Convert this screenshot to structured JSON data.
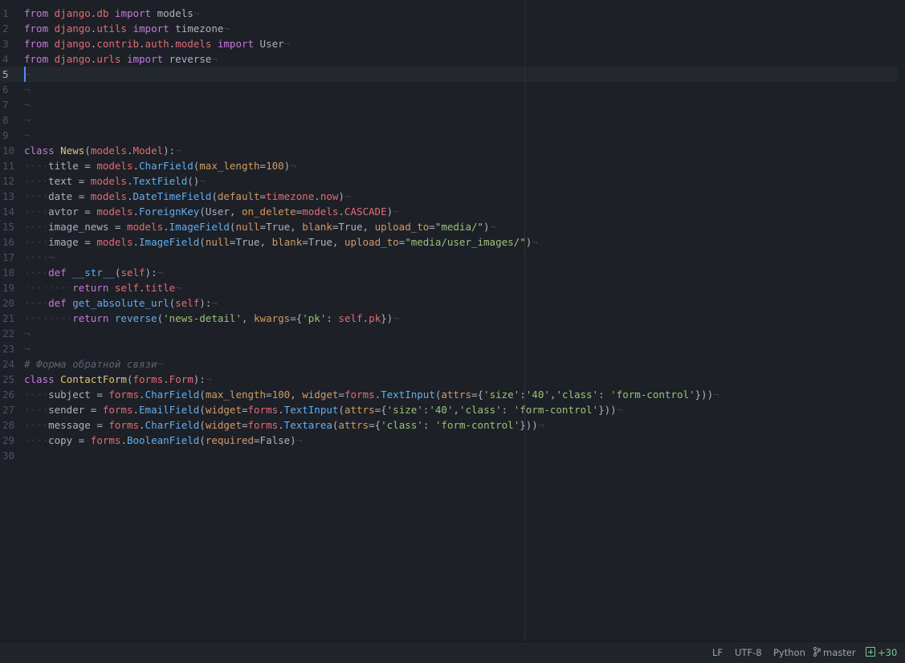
{
  "editor": {
    "active_line": 5,
    "line_numbers": [
      "1",
      "2",
      "3",
      "4",
      "5",
      "6",
      "7",
      "8",
      "9",
      "10",
      "11",
      "12",
      "13",
      "14",
      "15",
      "16",
      "17",
      "18",
      "19",
      "20",
      "21",
      "22",
      "23",
      "24",
      "25",
      "26",
      "27",
      "28",
      "29",
      "30"
    ],
    "eol_marker": "¬",
    "indent_marker": "····",
    "lines": [
      [
        [
          "kw",
          "from"
        ],
        [
          "plain",
          " "
        ],
        [
          "mod",
          "django"
        ],
        [
          "plain",
          "."
        ],
        [
          "mod",
          "db"
        ],
        [
          "plain",
          " "
        ],
        [
          "kw",
          "import"
        ],
        [
          "plain",
          " models"
        ]
      ],
      [
        [
          "kw",
          "from"
        ],
        [
          "plain",
          " "
        ],
        [
          "mod",
          "django"
        ],
        [
          "plain",
          "."
        ],
        [
          "mod",
          "utils"
        ],
        [
          "plain",
          " "
        ],
        [
          "kw",
          "import"
        ],
        [
          "plain",
          " timezone"
        ]
      ],
      [
        [
          "kw",
          "from"
        ],
        [
          "plain",
          " "
        ],
        [
          "mod",
          "django"
        ],
        [
          "plain",
          "."
        ],
        [
          "mod",
          "contrib"
        ],
        [
          "plain",
          "."
        ],
        [
          "mod",
          "auth"
        ],
        [
          "plain",
          "."
        ],
        [
          "mod",
          "models"
        ],
        [
          "plain",
          " "
        ],
        [
          "kw",
          "import"
        ],
        [
          "plain",
          " User"
        ]
      ],
      [
        [
          "kw",
          "from"
        ],
        [
          "plain",
          " "
        ],
        [
          "mod",
          "django"
        ],
        [
          "plain",
          "."
        ],
        [
          "mod",
          "urls"
        ],
        [
          "plain",
          " "
        ],
        [
          "kw",
          "import"
        ],
        [
          "plain",
          " reverse"
        ]
      ],
      [],
      [],
      [],
      [],
      [],
      [
        [
          "kw",
          "class"
        ],
        [
          "plain",
          " "
        ],
        [
          "cls",
          "News"
        ],
        [
          "plain",
          "("
        ],
        [
          "mod",
          "models"
        ],
        [
          "plain",
          "."
        ],
        [
          "mod",
          "Model"
        ],
        [
          "plain",
          "):"
        ]
      ],
      [
        [
          "ws",
          "····"
        ],
        [
          "plain",
          "title = "
        ],
        [
          "mod",
          "models"
        ],
        [
          "plain",
          "."
        ],
        [
          "fn",
          "CharField"
        ],
        [
          "plain",
          "("
        ],
        [
          "param",
          "max_length"
        ],
        [
          "plain",
          "="
        ],
        [
          "num",
          "100"
        ],
        [
          "plain",
          ")"
        ]
      ],
      [
        [
          "ws",
          "····"
        ],
        [
          "plain",
          "text = "
        ],
        [
          "mod",
          "models"
        ],
        [
          "plain",
          "."
        ],
        [
          "fn",
          "TextField"
        ],
        [
          "plain",
          "()"
        ]
      ],
      [
        [
          "ws",
          "····"
        ],
        [
          "plain",
          "date = "
        ],
        [
          "mod",
          "models"
        ],
        [
          "plain",
          "."
        ],
        [
          "fn",
          "DateTimeField"
        ],
        [
          "plain",
          "("
        ],
        [
          "param",
          "default"
        ],
        [
          "plain",
          "="
        ],
        [
          "mod",
          "timezone"
        ],
        [
          "plain",
          "."
        ],
        [
          "mod",
          "now"
        ],
        [
          "plain",
          ")"
        ]
      ],
      [
        [
          "ws",
          "····"
        ],
        [
          "plain",
          "avtor = "
        ],
        [
          "mod",
          "models"
        ],
        [
          "plain",
          "."
        ],
        [
          "fn",
          "ForeignKey"
        ],
        [
          "plain",
          "(User, "
        ],
        [
          "param",
          "on_delete"
        ],
        [
          "plain",
          "="
        ],
        [
          "mod",
          "models"
        ],
        [
          "plain",
          "."
        ],
        [
          "mod",
          "CASCADE"
        ],
        [
          "plain",
          ")"
        ]
      ],
      [
        [
          "ws",
          "····"
        ],
        [
          "plain",
          "image_news = "
        ],
        [
          "mod",
          "models"
        ],
        [
          "plain",
          "."
        ],
        [
          "fn",
          "ImageField"
        ],
        [
          "plain",
          "("
        ],
        [
          "param",
          "null"
        ],
        [
          "plain",
          "=True, "
        ],
        [
          "param",
          "blank"
        ],
        [
          "plain",
          "=True, "
        ],
        [
          "param",
          "upload_to"
        ],
        [
          "plain",
          "="
        ],
        [
          "str",
          "\"media/\""
        ],
        [
          "plain",
          ")"
        ]
      ],
      [
        [
          "ws",
          "····"
        ],
        [
          "plain",
          "image = "
        ],
        [
          "mod",
          "models"
        ],
        [
          "plain",
          "."
        ],
        [
          "fn",
          "ImageField"
        ],
        [
          "plain",
          "("
        ],
        [
          "param",
          "null"
        ],
        [
          "plain",
          "=True, "
        ],
        [
          "param",
          "blank"
        ],
        [
          "plain",
          "=True, "
        ],
        [
          "param",
          "upload_to"
        ],
        [
          "plain",
          "="
        ],
        [
          "str",
          "\"media/user_images/\""
        ],
        [
          "plain",
          ")"
        ]
      ],
      [
        [
          "ws",
          "····"
        ]
      ],
      [
        [
          "ws",
          "····"
        ],
        [
          "kw",
          "def"
        ],
        [
          "plain",
          " "
        ],
        [
          "fn",
          "__str__"
        ],
        [
          "plain",
          "("
        ],
        [
          "self",
          "self"
        ],
        [
          "plain",
          "):"
        ]
      ],
      [
        [
          "ws",
          "········"
        ],
        [
          "kw",
          "return"
        ],
        [
          "plain",
          " "
        ],
        [
          "self",
          "self"
        ],
        [
          "plain",
          "."
        ],
        [
          "attr",
          "title"
        ]
      ],
      [
        [
          "ws",
          "····"
        ],
        [
          "kw",
          "def"
        ],
        [
          "plain",
          " "
        ],
        [
          "fn",
          "get_absolute_url"
        ],
        [
          "plain",
          "("
        ],
        [
          "self",
          "self"
        ],
        [
          "plain",
          "):"
        ]
      ],
      [
        [
          "ws",
          "········"
        ],
        [
          "kw",
          "return"
        ],
        [
          "plain",
          " "
        ],
        [
          "fn",
          "reverse"
        ],
        [
          "plain",
          "("
        ],
        [
          "str",
          "'news-detail'"
        ],
        [
          "plain",
          ", "
        ],
        [
          "param",
          "kwargs"
        ],
        [
          "plain",
          "={"
        ],
        [
          "str",
          "'pk'"
        ],
        [
          "plain",
          ": "
        ],
        [
          "self",
          "self"
        ],
        [
          "plain",
          "."
        ],
        [
          "attr",
          "pk"
        ],
        [
          "plain",
          "})"
        ]
      ],
      [],
      [],
      [
        [
          "cmt",
          "# Форма обратной связи"
        ]
      ],
      [
        [
          "kw",
          "class"
        ],
        [
          "plain",
          " "
        ],
        [
          "cls",
          "ContactForm"
        ],
        [
          "plain",
          "("
        ],
        [
          "mod",
          "forms"
        ],
        [
          "plain",
          "."
        ],
        [
          "mod",
          "Form"
        ],
        [
          "plain",
          "):"
        ]
      ],
      [
        [
          "ws",
          "····"
        ],
        [
          "plain",
          "subject = "
        ],
        [
          "mod",
          "forms"
        ],
        [
          "plain",
          "."
        ],
        [
          "fn",
          "CharField"
        ],
        [
          "plain",
          "("
        ],
        [
          "param",
          "max_length"
        ],
        [
          "plain",
          "="
        ],
        [
          "num",
          "100"
        ],
        [
          "plain",
          ", "
        ],
        [
          "param",
          "widget"
        ],
        [
          "plain",
          "="
        ],
        [
          "mod",
          "forms"
        ],
        [
          "plain",
          "."
        ],
        [
          "fn",
          "TextInput"
        ],
        [
          "plain",
          "("
        ],
        [
          "param",
          "attrs"
        ],
        [
          "plain",
          "={"
        ],
        [
          "str",
          "'size'"
        ],
        [
          "plain",
          ":"
        ],
        [
          "str",
          "'40'"
        ],
        [
          "plain",
          ","
        ],
        [
          "str",
          "'class'"
        ],
        [
          "plain",
          ": "
        ],
        [
          "str",
          "'form-control'"
        ],
        [
          "plain",
          "}))"
        ]
      ],
      [
        [
          "ws",
          "····"
        ],
        [
          "plain",
          "sender = "
        ],
        [
          "mod",
          "forms"
        ],
        [
          "plain",
          "."
        ],
        [
          "fn",
          "EmailField"
        ],
        [
          "plain",
          "("
        ],
        [
          "param",
          "widget"
        ],
        [
          "plain",
          "="
        ],
        [
          "mod",
          "forms"
        ],
        [
          "plain",
          "."
        ],
        [
          "fn",
          "TextInput"
        ],
        [
          "plain",
          "("
        ],
        [
          "param",
          "attrs"
        ],
        [
          "plain",
          "={"
        ],
        [
          "str",
          "'size'"
        ],
        [
          "plain",
          ":"
        ],
        [
          "str",
          "'40'"
        ],
        [
          "plain",
          ","
        ],
        [
          "str",
          "'class'"
        ],
        [
          "plain",
          ": "
        ],
        [
          "str",
          "'form-control'"
        ],
        [
          "plain",
          "}))"
        ]
      ],
      [
        [
          "ws",
          "····"
        ],
        [
          "plain",
          "message = "
        ],
        [
          "mod",
          "forms"
        ],
        [
          "plain",
          "."
        ],
        [
          "fn",
          "CharField"
        ],
        [
          "plain",
          "("
        ],
        [
          "param",
          "widget"
        ],
        [
          "plain",
          "="
        ],
        [
          "mod",
          "forms"
        ],
        [
          "plain",
          "."
        ],
        [
          "fn",
          "Textarea"
        ],
        [
          "plain",
          "("
        ],
        [
          "param",
          "attrs"
        ],
        [
          "plain",
          "={"
        ],
        [
          "str",
          "'class'"
        ],
        [
          "plain",
          ": "
        ],
        [
          "str",
          "'form-control'"
        ],
        [
          "plain",
          "}))"
        ]
      ],
      [
        [
          "ws",
          "····"
        ],
        [
          "plain",
          "copy = "
        ],
        [
          "mod",
          "forms"
        ],
        [
          "plain",
          "."
        ],
        [
          "fn",
          "BooleanField"
        ],
        [
          "plain",
          "("
        ],
        [
          "param",
          "required"
        ],
        [
          "plain",
          "=False)"
        ]
      ],
      []
    ],
    "no_eol_lines": [
      30
    ]
  },
  "statusbar": {
    "line_ending": "LF",
    "encoding": "UTF-8",
    "grammar": "Python",
    "branch": "master",
    "git_added": "+30"
  },
  "colors": {
    "background": "#1d2026",
    "keyword": "#c678dd",
    "module": "#e06c75",
    "class_name": "#e5c07b",
    "function": "#61afef",
    "parameter": "#d19a66",
    "string": "#98c379",
    "comment": "#5c6370",
    "caret": "#528bff",
    "git_added": "#73c990"
  }
}
